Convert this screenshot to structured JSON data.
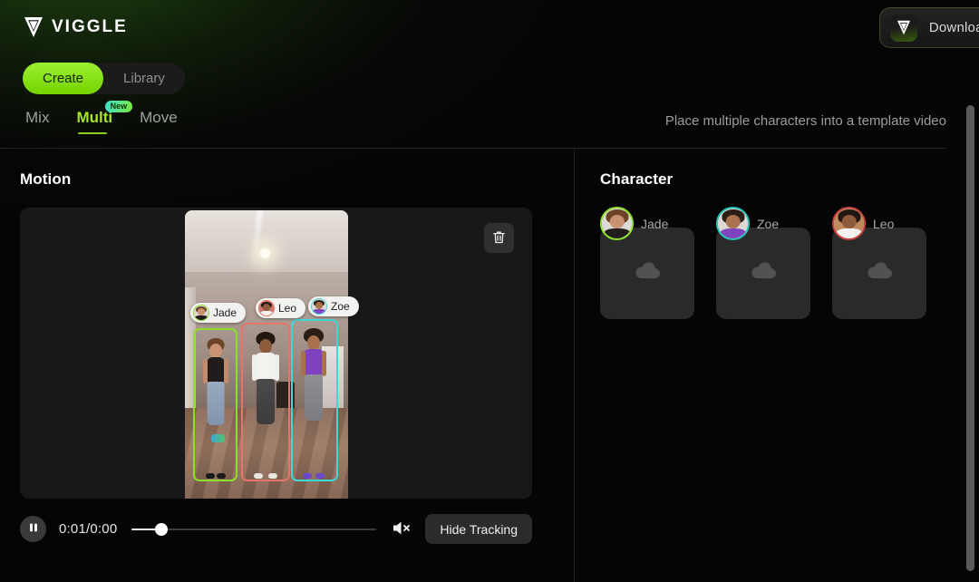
{
  "brand": {
    "name": "VIGGLE",
    "logo_icon": "viggle-chevron-logo"
  },
  "header": {
    "download_banner": {
      "label": "Download the",
      "icon": "viggle-app-badge-icon"
    }
  },
  "mode_toggle": {
    "options": [
      {
        "label": "Create",
        "active": true
      },
      {
        "label": "Library",
        "active": false
      }
    ]
  },
  "tabs": {
    "items": [
      {
        "label": "Mix",
        "active": false
      },
      {
        "label": "Multi",
        "active": true,
        "badge": "New"
      },
      {
        "label": "Move",
        "active": false
      }
    ]
  },
  "tagline": "Place multiple characters into a template video",
  "motion_panel": {
    "title": "Motion",
    "delete_icon": "trash-icon",
    "tracked": [
      {
        "name": "Jade",
        "color": "#8ede2e"
      },
      {
        "name": "Leo",
        "color": "#e8736b"
      },
      {
        "name": "Zoe",
        "color": "#3fd8d8"
      }
    ],
    "player": {
      "state_icon": "pause-icon",
      "time": "0:01/0:00",
      "progress_percent": 12,
      "volume_icon": "speaker-muted-icon",
      "hide_tracking_label": "Hide Tracking"
    }
  },
  "character_panel": {
    "title": "Character",
    "slots": [
      {
        "name": "Jade",
        "ring_color": "#8ede2e",
        "upload_icon": "cloud-upload-icon"
      },
      {
        "name": "Zoe",
        "ring_color": "#25c5b4",
        "upload_icon": "cloud-upload-icon"
      },
      {
        "name": "Leo",
        "ring_color": "#c7413c",
        "upload_icon": "cloud-upload-icon"
      }
    ]
  },
  "colors": {
    "accent_green": "#8ede2e",
    "background": "#050505",
    "panel": "#181818"
  }
}
